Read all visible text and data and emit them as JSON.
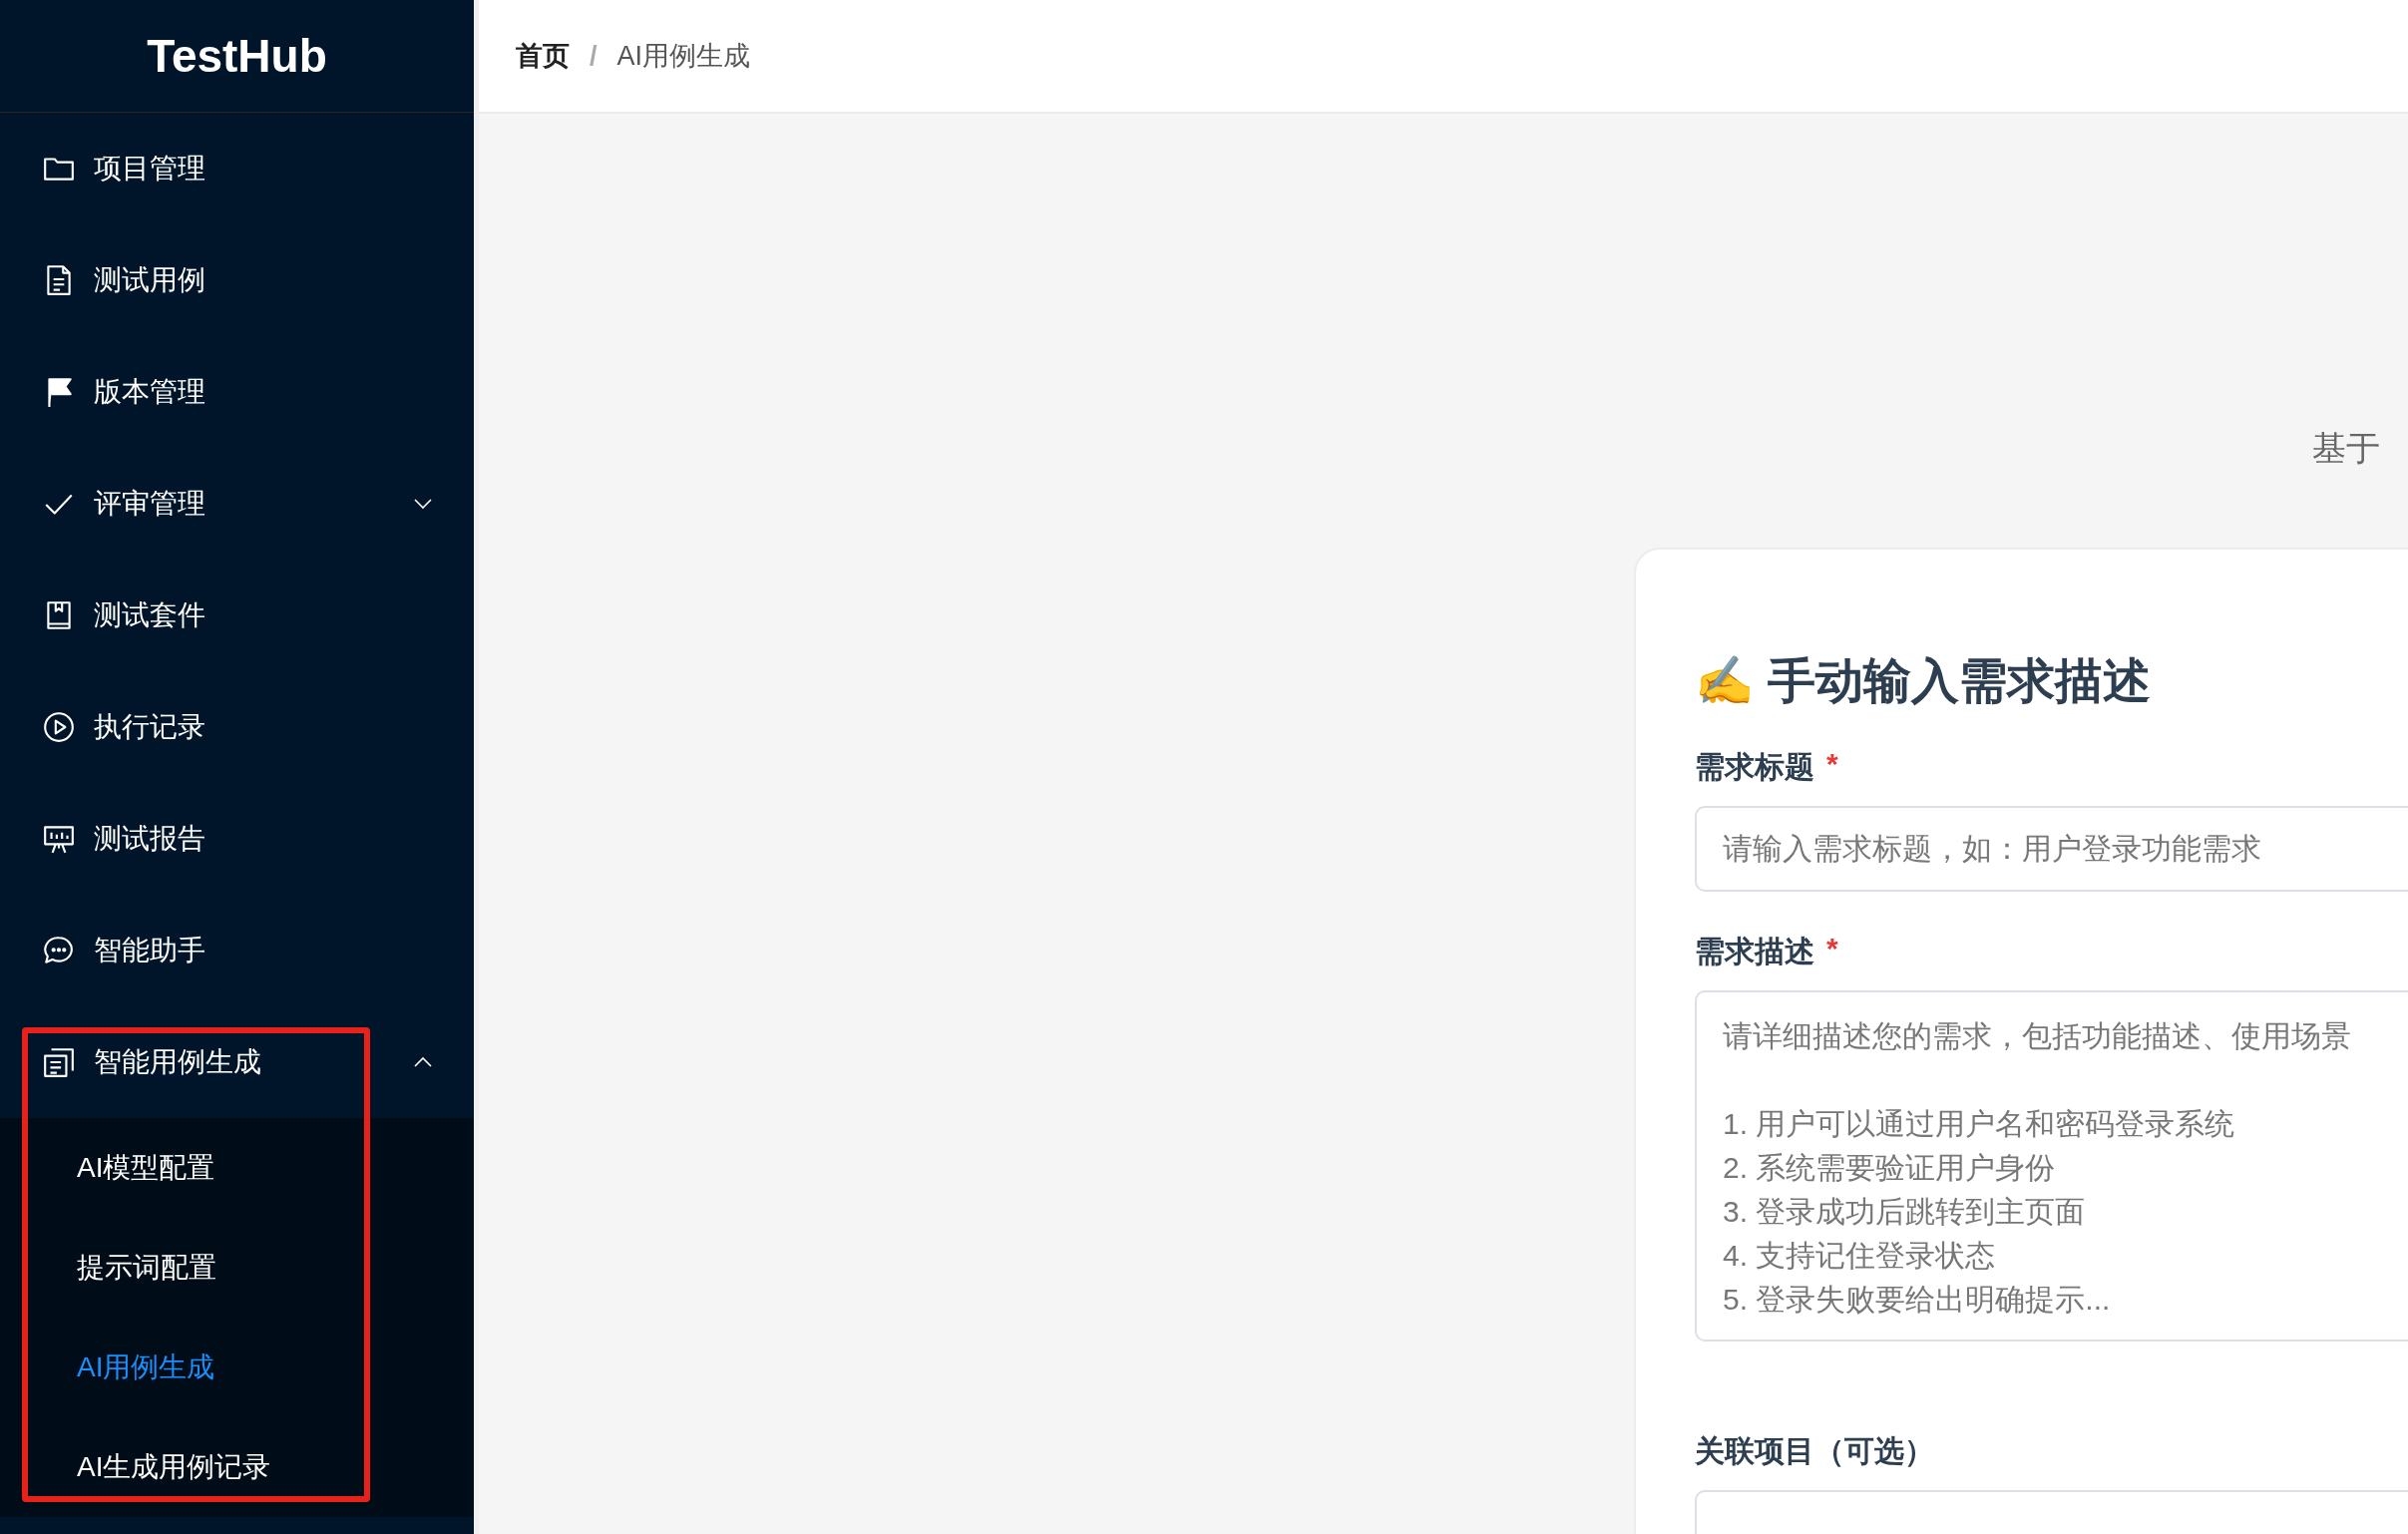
{
  "sidebar": {
    "logo": "TestHub",
    "items": [
      {
        "label": "项目管理",
        "kind": "link",
        "selected": false
      },
      {
        "label": "测试用例",
        "kind": "link",
        "selected": false
      },
      {
        "label": "版本管理",
        "kind": "link",
        "selected": false
      },
      {
        "label": "评审管理",
        "kind": "submenu",
        "selected": false,
        "expanded": false
      },
      {
        "label": "测试套件",
        "kind": "link",
        "selected": false
      },
      {
        "label": "执行记录",
        "kind": "link",
        "selected": false
      },
      {
        "label": "测试报告",
        "kind": "link",
        "selected": false
      },
      {
        "label": "智能助手",
        "kind": "link",
        "selected": false
      },
      {
        "label": "智能用例生成",
        "kind": "submenu",
        "selected": false,
        "expanded": true,
        "children": [
          {
            "label": "AI模型配置",
            "selected": false
          },
          {
            "label": "提示词配置",
            "selected": false
          },
          {
            "label": "AI用例生成",
            "selected": true
          },
          {
            "label": "AI生成用例记录",
            "selected": false
          }
        ]
      }
    ]
  },
  "breadcrumb": [
    {
      "label": "首页",
      "current": false
    },
    {
      "label": "AI用例生成",
      "current": true
    }
  ],
  "breadcrumb_separator": "/",
  "subtitle": "基于",
  "card": {
    "title": "✍️ 手动输入需求描述",
    "fields": [
      {
        "kind": "input",
        "label": "需求标题",
        "required_mark": "*",
        "placeholder": "请输入需求标题，如：用户登录功能需求"
      },
      {
        "kind": "textarea",
        "label": "需求描述",
        "required_mark": "*",
        "placeholder": "请详细描述您的需求，包括功能描述、使用场景\n\n1. 用户可以通过用户名和密码登录系统\n2. 系统需要验证用户身份\n3. 登录成功后跳转到主页面\n4. 支持记住登录状态\n5. 登录失败要给出明确提示..."
      },
      {
        "kind": "select",
        "label": "关联项目（可选）"
      }
    ]
  }
}
